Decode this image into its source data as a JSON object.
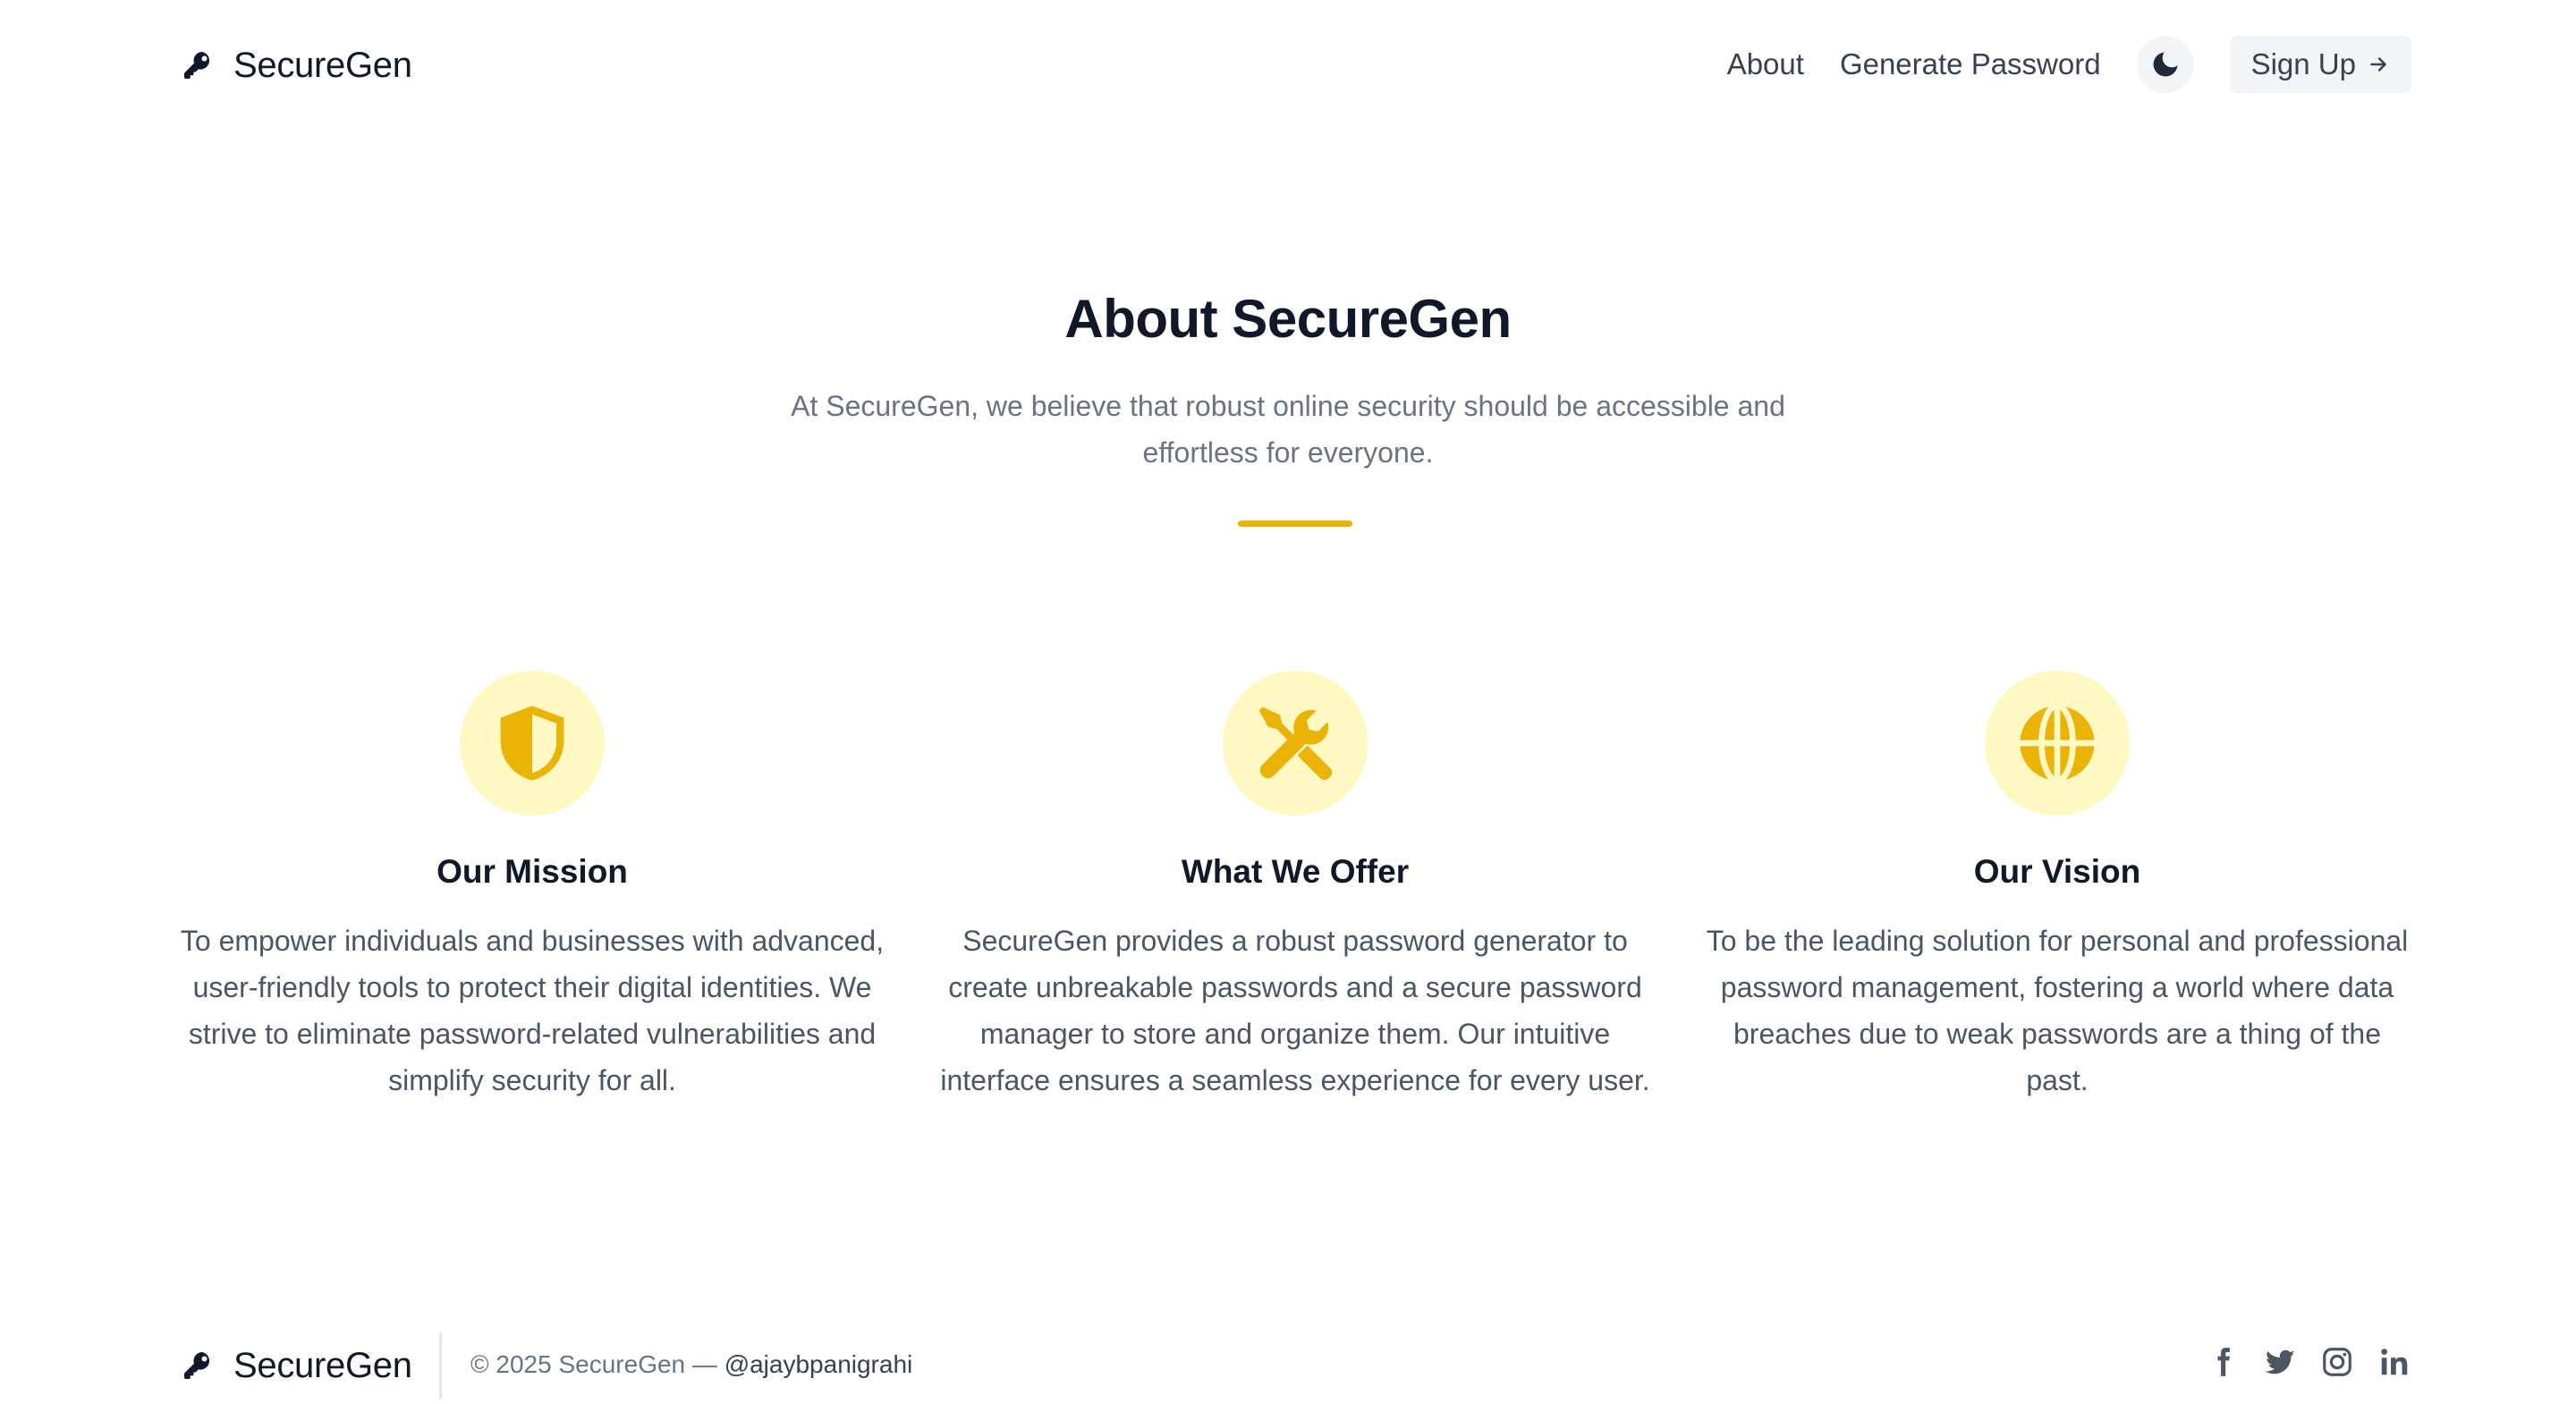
{
  "header": {
    "brand": "SecureGen",
    "nav": {
      "about": "About",
      "generate": "Generate Password"
    },
    "signup_label": "Sign Up"
  },
  "hero": {
    "title": "About SecureGen",
    "subtitle": "At SecureGen, we believe that robust online security should be accessible and effortless for everyone."
  },
  "features": [
    {
      "icon": "shield-icon",
      "title": "Our Mission",
      "description": "To empower individuals and businesses with advanced, user-friendly tools to protect their digital identities. We strive to eliminate password-related vulnerabilities and simplify security for all."
    },
    {
      "icon": "tools-icon",
      "title": "What We Offer",
      "description": "SecureGen provides a robust password generator to create unbreakable passwords and a secure password manager to store and organize them. Our intuitive interface ensures a seamless experience for every user."
    },
    {
      "icon": "globe-icon",
      "title": "Our Vision",
      "description": "To be the leading solution for personal and professional password management, fostering a world where data breaches due to weak passwords are a thing of the past."
    }
  ],
  "footer": {
    "brand": "SecureGen",
    "copyright": "© 2025 SecureGen — ",
    "handle": "@ajaybpanigrahi",
    "socials": [
      "facebook-icon",
      "twitter-icon",
      "instagram-icon",
      "linkedin-icon"
    ]
  },
  "colors": {
    "accent": "#eab308",
    "accent_light": "#fef9c3",
    "text_dark": "#111827",
    "text_muted": "#6b7280"
  }
}
